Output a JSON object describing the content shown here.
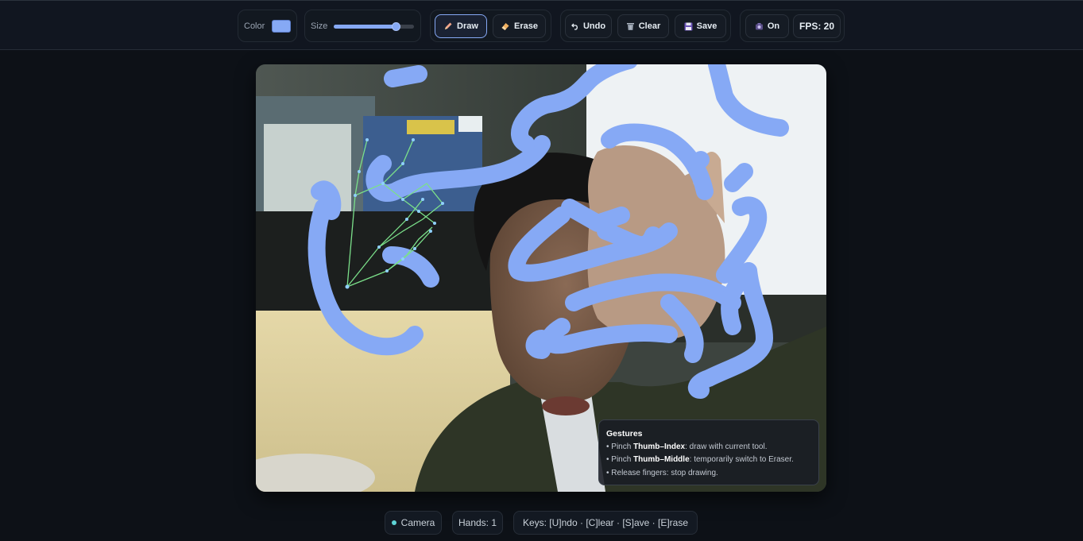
{
  "toolbar": {
    "color_label": "Color",
    "color_value": "#86a9f5",
    "size_label": "Size",
    "size_fraction": 0.78,
    "draw_label": "Draw",
    "erase_label": "Erase",
    "undo_label": "Undo",
    "clear_label": "Clear",
    "save_label": "Save",
    "camera_toggle_label": "On",
    "fps_text": "FPS: 20",
    "icons": {
      "draw": "pencil-icon",
      "erase": "eraser-icon",
      "undo": "undo-arrow-icon",
      "clear": "trash-icon",
      "save": "floppy-disk-icon",
      "camera": "camera-icon"
    }
  },
  "gestures": {
    "title": "Gestures",
    "items": [
      {
        "prefix": "• Pinch ",
        "bold": "Thumb–Index",
        "suffix": ": draw with current tool."
      },
      {
        "prefix": "• Pinch ",
        "bold": "Thumb–Middle",
        "suffix": ": temporarily switch to Eraser."
      },
      {
        "prefix": "• Release fingers: stop drawing.",
        "bold": "",
        "suffix": ""
      }
    ]
  },
  "status": {
    "camera_label": "Camera",
    "hands_label": "Hands: 1",
    "keys_label": "Keys: [U]ndo · [C]lear · [S]ave · [E]rase"
  },
  "colors": {
    "stroke": "#86a9f5",
    "landmarks": "#7be08a",
    "background": "#0d1117"
  }
}
